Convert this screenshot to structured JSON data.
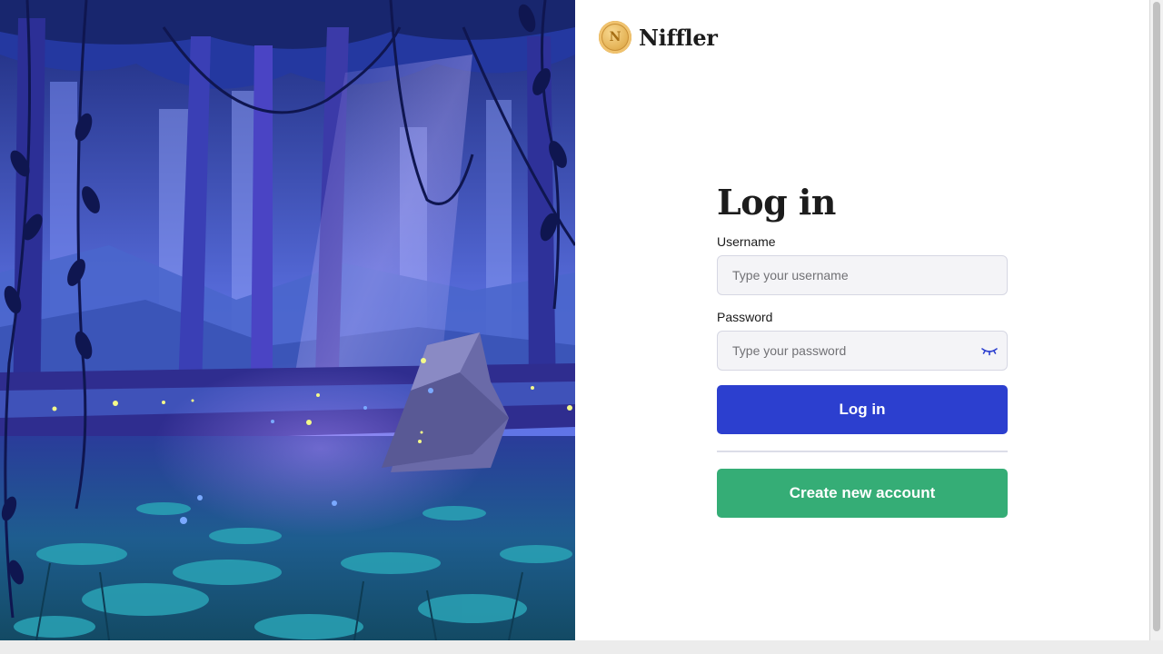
{
  "brand": {
    "name": "Niffler",
    "coin_letter": "N"
  },
  "login_form": {
    "title": "Log in",
    "username": {
      "label": "Username",
      "placeholder": "Type your username",
      "value": ""
    },
    "password": {
      "label": "Password",
      "placeholder": "Type your password",
      "value": "",
      "toggle_icon": "eye-closed-icon"
    },
    "login_button": "Log in",
    "create_account_button": "Create new account"
  },
  "colors": {
    "primary": "#2c3fcf",
    "success": "#35ad76",
    "coin": "#e5b458"
  }
}
